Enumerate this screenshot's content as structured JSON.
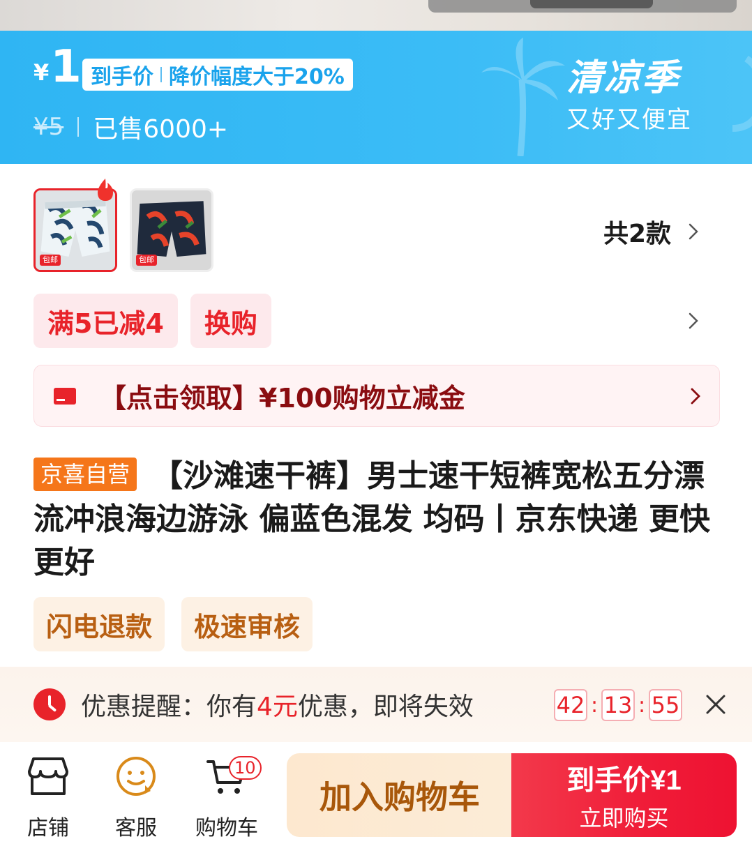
{
  "price_banner": {
    "currency": "¥",
    "price": "1",
    "tag_left": "到手价",
    "tag_right": "降价幅度大于20%",
    "old_price": "¥5",
    "sold": "已售6000+",
    "season_title": "清凉季",
    "season_sub": "又好又便宜"
  },
  "variants": {
    "items": [
      {
        "badge": "包邮",
        "selected": true,
        "icon": "shorts-blue-palm"
      },
      {
        "badge": "包邮",
        "selected": false,
        "icon": "shorts-navy-red-floral"
      }
    ],
    "count_label": "共2款"
  },
  "promos": [
    "满5已减4",
    "换购"
  ],
  "coupon": {
    "text": "【点击领取】¥100购物立减金",
    "icon": "red-envelope-icon"
  },
  "title": {
    "badge": "京喜自营",
    "text": "【沙滩速干裤】男士速干短裤宽松五分漂流冲浪海边游泳 偏蓝色混发 均码丨京东快递 更快更好"
  },
  "services": [
    "闪电退款",
    "极速审核"
  ],
  "reminder": {
    "prefix": "优惠提醒：你有",
    "amount": "4元",
    "suffix": "优惠，即将失效",
    "timer": {
      "h": "42",
      "m": "13",
      "s": "55"
    }
  },
  "bottom_nav": {
    "store": "店铺",
    "service": "客服",
    "cart": "购物车",
    "cart_count": "10",
    "add_to_cart": "加入购物车",
    "buy_line1": "到手价¥1",
    "buy_line2": "立即购买"
  },
  "colors": {
    "banner_blue": "#2fb5f3",
    "accent_red": "#e8232a",
    "self_badge_orange": "#f5761a",
    "service_brown": "#b85f12"
  }
}
